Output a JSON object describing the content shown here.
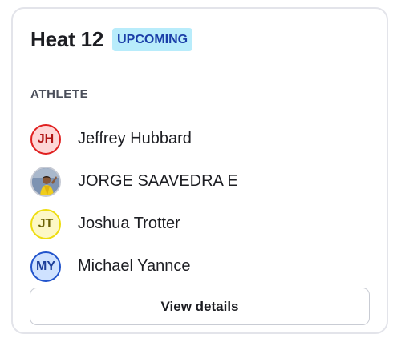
{
  "heat": {
    "title": "Heat 12",
    "status_badge": "UPCOMING"
  },
  "athletes_section": {
    "label": "ATHLETE",
    "items": [
      {
        "initials": "JH",
        "name": "Jeffrey Hubbard",
        "avatar_color": "#e02020"
      },
      {
        "initials": "",
        "name": "JORGE SAAVEDRA E",
        "avatar_type": "photo"
      },
      {
        "initials": "JT",
        "name": "Joshua Trotter",
        "avatar_color": "#eedd10"
      },
      {
        "initials": "MY",
        "name": "Michael Yannce",
        "avatar_color": "#2254cc"
      }
    ]
  },
  "actions": {
    "view_details_label": "View details"
  },
  "colors": {
    "badge_background": "#b8ecfb",
    "badge_text": "#1a3ea8",
    "card_border": "#e3e4ea"
  }
}
